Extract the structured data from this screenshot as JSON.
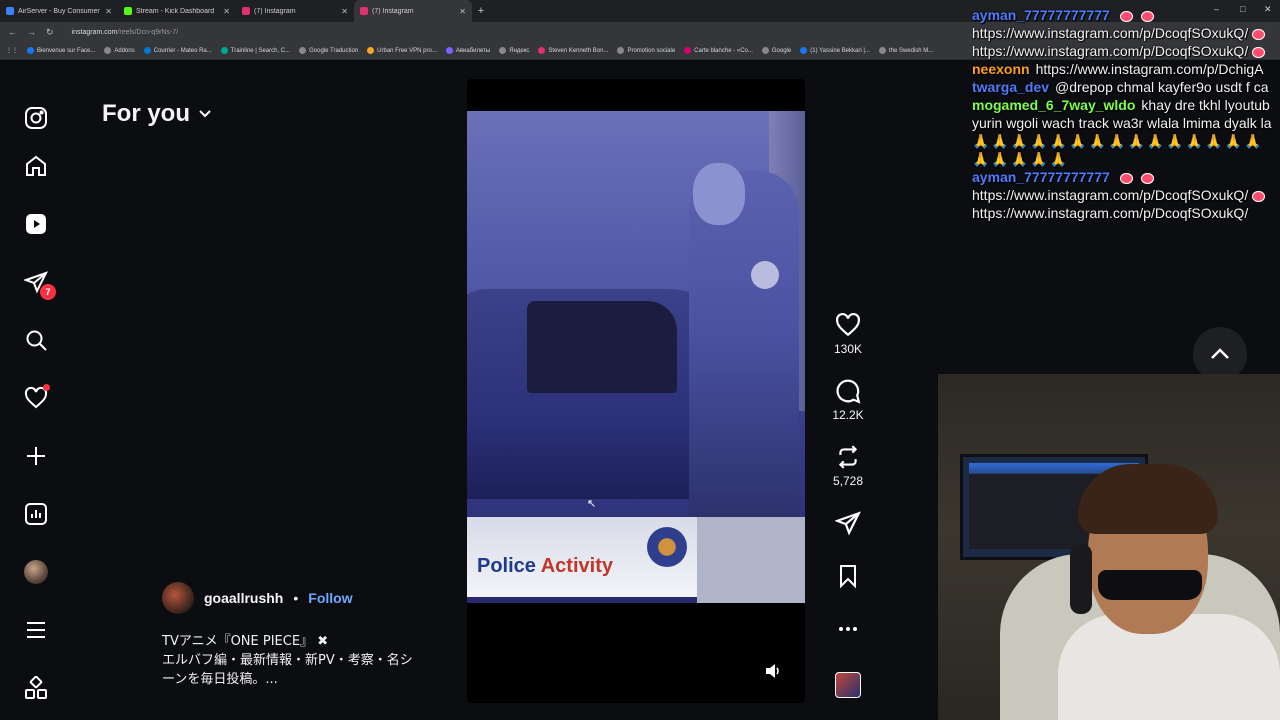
{
  "browser": {
    "tabs": [
      {
        "title": "AirServer - Buy Consumer Licen",
        "color": "#3b82f6",
        "active": false
      },
      {
        "title": "Stream - Kick Dashboard",
        "color": "#53fc18",
        "active": false
      },
      {
        "title": "(7) Instagram",
        "color": "#e1306c",
        "active": false
      },
      {
        "title": "(7) Instagram",
        "color": "#e1306c",
        "active": true
      }
    ],
    "url_host": "instagram.com",
    "url_path": "/reels/Dcn-q9rNs-7/",
    "bookmarks": [
      {
        "label": "Bienvenue sur Face...",
        "color": "#1877f2"
      },
      {
        "label": "Addons",
        "color": "#888888"
      },
      {
        "label": "Courrier - Mateo Ra...",
        "color": "#0078d4"
      },
      {
        "label": "Trainline | Search, C...",
        "color": "#00a88f"
      },
      {
        "label": "Google Traduction",
        "color": "#888888"
      },
      {
        "label": "Urban Free VPN pro...",
        "color": "#f5a623"
      },
      {
        "label": "Авиабилеты",
        "color": "#7b61ff"
      },
      {
        "label": "Яндекс",
        "color": "#888888"
      },
      {
        "label": "Steven Kenneth Bon...",
        "color": "#e1306c"
      },
      {
        "label": "Promotion sociale",
        "color": "#888888"
      },
      {
        "label": "Carte blanche - «Co...",
        "color": "#d6006e"
      },
      {
        "label": "Google",
        "color": "#888888"
      },
      {
        "label": "(1) Yassine Bekkari |...",
        "color": "#1877f2"
      },
      {
        "label": "the Swedish M...",
        "color": "#888888"
      }
    ]
  },
  "sidebar": {
    "messages_badge": "7"
  },
  "feed": {
    "title": "For you"
  },
  "video": {
    "sign_text_1": "Police ",
    "sign_text_2": "Activity"
  },
  "actions": {
    "likes": "130K",
    "comments": "12.2K",
    "reposts": "5,728"
  },
  "post": {
    "author": "goaallrushh",
    "separator": "•",
    "follow_label": "Follow",
    "caption_lines": [
      "TVアニメ『ONE PIECE』 ✖",
      "エルバフ編・最新情報・新PV・考察・名シ",
      "ーンを毎日投稿。..."
    ]
  },
  "chat": {
    "messages": [
      {
        "user": "ayman_77777777777",
        "color": "#4f7bff",
        "text": "",
        "hearts": 2
      },
      {
        "user": "",
        "color": "",
        "text": "https://www.instagram.com/p/DcoqfSOxukQ/",
        "hearts": 1
      },
      {
        "user": "",
        "color": "",
        "text": "https://www.instagram.com/p/DcoqfSOxukQ/",
        "hearts": 1
      },
      {
        "user": "neexonn",
        "color": "#ff9f1a",
        "text": "https://www.instagram.com/p/DchigA",
        "hearts": 0
      },
      {
        "user": "twarga_dev",
        "color": "#4f7bff",
        "text": "@drepop chmal kayfer9o usdt f ca",
        "hearts": 0
      },
      {
        "user": "mogamed_6_7way_wldo",
        "color": "#7cff4a",
        "text": "khay dre tkhl lyoutub",
        "hearts": 0
      },
      {
        "user": "",
        "color": "",
        "text": "yurin wgoli wach track wa3r wlala lmima dyalk la",
        "hearts": 0
      },
      {
        "user": "",
        "color": "",
        "text": "🙏🙏🙏🙏🙏🙏🙏🙏🙏🙏🙏🙏🙏🙏🙏",
        "hearts": 0,
        "pray": true
      },
      {
        "user": "",
        "color": "",
        "text": "🙏🙏🙏🙏🙏",
        "hearts": 0,
        "pray": true
      },
      {
        "user": "ayman_77777777777",
        "color": "#4f7bff",
        "text": "",
        "hearts": 2
      },
      {
        "user": "",
        "color": "",
        "text": "https://www.instagram.com/p/DcoqfSOxukQ/",
        "hearts": 1
      },
      {
        "user": "",
        "color": "",
        "text": "https://www.instagram.com/p/DcoqfSOxukQ/",
        "hearts": 0
      }
    ]
  }
}
